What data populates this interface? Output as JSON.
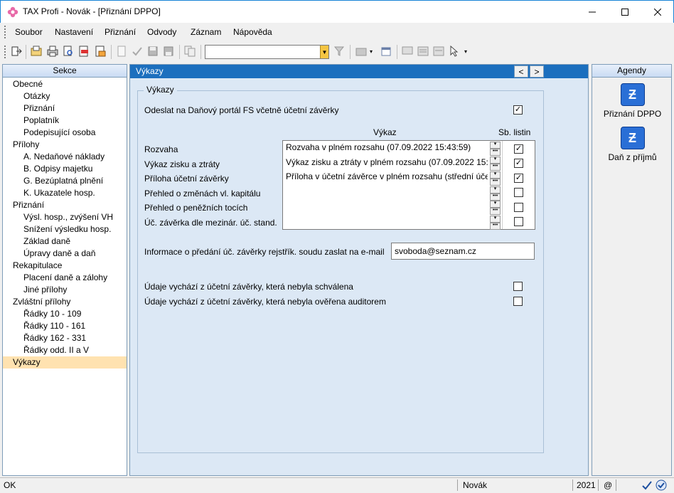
{
  "window": {
    "title": "TAX Profi - Novák - [Přiznání DPPO]"
  },
  "menu": {
    "items": [
      {
        "label": "Soubor"
      },
      {
        "label": "Nastavení"
      },
      {
        "label": "Přiznání"
      },
      {
        "label": "Odvody"
      },
      {
        "label": "Záznam"
      },
      {
        "label": "Nápověda"
      }
    ]
  },
  "toolbar": {
    "combo_value": ""
  },
  "sidebar": {
    "header": "Sekce",
    "items": [
      {
        "label": "Obecné",
        "level": 0
      },
      {
        "label": "Otázky",
        "level": 1
      },
      {
        "label": "Přiznání",
        "level": 1
      },
      {
        "label": "Poplatník",
        "level": 1
      },
      {
        "label": "Podepisující osoba",
        "level": 1
      },
      {
        "label": "Přílohy",
        "level": 0
      },
      {
        "label": "A. Nedaňové náklady",
        "level": 1
      },
      {
        "label": "B. Odpisy majetku",
        "level": 1
      },
      {
        "label": "G. Bezúplatná plnění",
        "level": 1
      },
      {
        "label": "K. Ukazatele hosp.",
        "level": 1
      },
      {
        "label": "Přiznání",
        "level": 0
      },
      {
        "label": "Výsl. hosp., zvýšení VH",
        "level": 1
      },
      {
        "label": "Snížení výsledku hosp.",
        "level": 1
      },
      {
        "label": "Základ daně",
        "level": 1
      },
      {
        "label": "Úpravy daně a daň",
        "level": 1
      },
      {
        "label": "Rekapitulace",
        "level": 0
      },
      {
        "label": "Placení daně a zálohy",
        "level": 1
      },
      {
        "label": "Jiné přílohy",
        "level": 1
      },
      {
        "label": "Zvláštní přílohy",
        "level": 0
      },
      {
        "label": "Řádky 10 - 109",
        "level": 1
      },
      {
        "label": "Řádky 110 - 161",
        "level": 1
      },
      {
        "label": "Řádky 162 - 331",
        "level": 1
      },
      {
        "label": "Řádky odd. II a V",
        "level": 1
      },
      {
        "label": "Výkazy",
        "level": 0,
        "selected": true
      }
    ]
  },
  "main": {
    "header": "Výkazy",
    "nav_prev": "<",
    "nav_next": ">",
    "group_label": "Výkazy",
    "send_label": "Odeslat na Daňový portál FS včetně účetní závěrky",
    "send_checked": "✓",
    "col_vykaz": "Výkaz",
    "col_sblistin": "Sb. listin",
    "rows": [
      {
        "label": "Rozvaha",
        "value": "Rozvaha v plném rozsahu (07.09.2022 15:43:59)",
        "checked": "✓"
      },
      {
        "label": "Výkaz zisku a ztráty",
        "value": "Výkaz zisku a ztráty v plném rozsahu (07.09.2022 15:43:",
        "checked": "✓"
      },
      {
        "label": "Příloha účetní závěrky",
        "value": "Příloha v účetní závěrce v plném rozsahu (střední účet",
        "checked": "✓"
      },
      {
        "label": "Přehled o změnách vl. kapitálu",
        "value": "",
        "checked": ""
      },
      {
        "label": "Přehled o peněžních tocích",
        "value": "",
        "checked": ""
      },
      {
        "label": "Úč. závěrka dle mezinár. úč. stand.",
        "value": "",
        "checked": ""
      }
    ],
    "email_label": "Informace o předání úč. závěrky rejstřík. soudu zaslat na e-mail",
    "email_value": "svoboda@seznam.cz",
    "unapproved_label": "Údaje vychází z účetní závěrky, která nebyla schválena",
    "unapproved_checked": "",
    "unaudited_label": "Údaje vychází z účetní závěrky, která nebyla ověřena auditorem",
    "unaudited_checked": ""
  },
  "agendy": {
    "header": "Agendy",
    "items": [
      {
        "label": "Přiznání DPPO"
      },
      {
        "label": "Daň z příjmů"
      }
    ]
  },
  "status": {
    "left": "OK",
    "user": "Novák",
    "year": "2021",
    "at": "@"
  },
  "colors": {
    "accent": "#1c6fbe",
    "selected": "#ffe2b0",
    "panel_bg": "#dce8f5"
  }
}
